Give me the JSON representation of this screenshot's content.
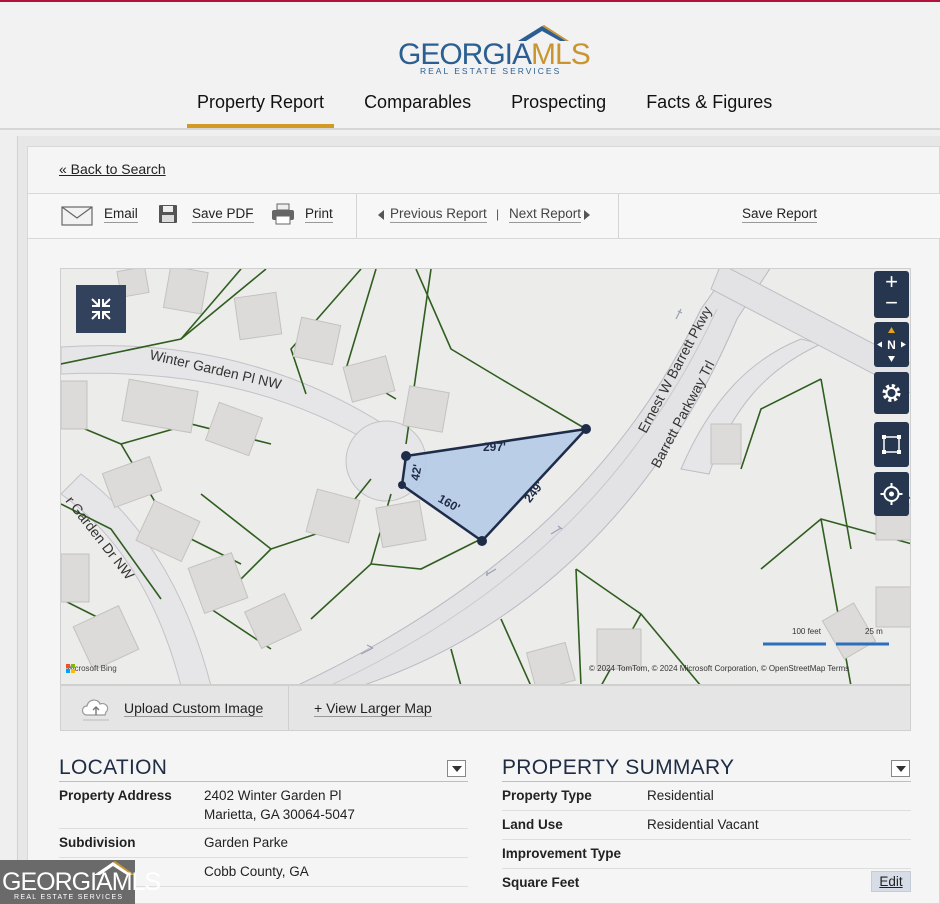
{
  "brand": {
    "name_part1": "GEORGIA",
    "name_part2": "MLS",
    "tagline": "REAL ESTATE SERVICES",
    "primary_color": "#2b5f93",
    "accent_color": "#c9952f"
  },
  "nav": {
    "tabs": [
      {
        "label": "Property Report",
        "active": true
      },
      {
        "label": "Comparables",
        "active": false
      },
      {
        "label": "Prospecting",
        "active": false
      },
      {
        "label": "Facts & Figures",
        "active": false
      }
    ]
  },
  "back_link": "« Back to Search",
  "toolbar": {
    "email": "Email",
    "save_pdf": "Save PDF",
    "print": "Print",
    "previous_report": "Previous Report",
    "divider": "|",
    "next_report": "Next Report",
    "save_report": "Save Report"
  },
  "map": {
    "streets": {
      "winter_garden_pl": "Winter Garden Pl NW",
      "winter_garden_dr": "r Garden Dr NW",
      "barrett_pkwy": "Ernest W Barrett Pkwy",
      "barrett_trl": "Barrett Parkway Trl"
    },
    "parcel_dimensions": {
      "north": "297'",
      "west": "42'",
      "south": "160'",
      "east": "249'"
    },
    "controls": {
      "zoom_in": "+",
      "zoom_out": "−",
      "compass": "N"
    },
    "provider": "Microsoft Bing",
    "attribution": "© 2024 TomTom, © 2024 Microsoft Corporation, © OpenStreetMap   Terms",
    "scale_feet": "100 feet",
    "scale_meters": "25 m",
    "upload_custom_image": "Upload Custom Image",
    "view_larger_map": "+ View Larger Map"
  },
  "location": {
    "title": "LOCATION",
    "rows": [
      {
        "label": "Property Address",
        "value_line1": "2402 Winter Garden Pl",
        "value_line2": "Marietta, GA 30064-5047"
      },
      {
        "label": "Subdivision",
        "value_line1": "Garden Parke"
      },
      {
        "label": "",
        "value_line1": "Cobb County, GA"
      }
    ]
  },
  "summary": {
    "title": "PROPERTY SUMMARY",
    "rows": [
      {
        "label": "Property Type",
        "value": "Residential"
      },
      {
        "label": "Land Use",
        "value": "Residential Vacant"
      },
      {
        "label": "Improvement Type",
        "value": ""
      },
      {
        "label": "Square Feet",
        "value": ""
      }
    ],
    "edit_label": "Edit"
  }
}
